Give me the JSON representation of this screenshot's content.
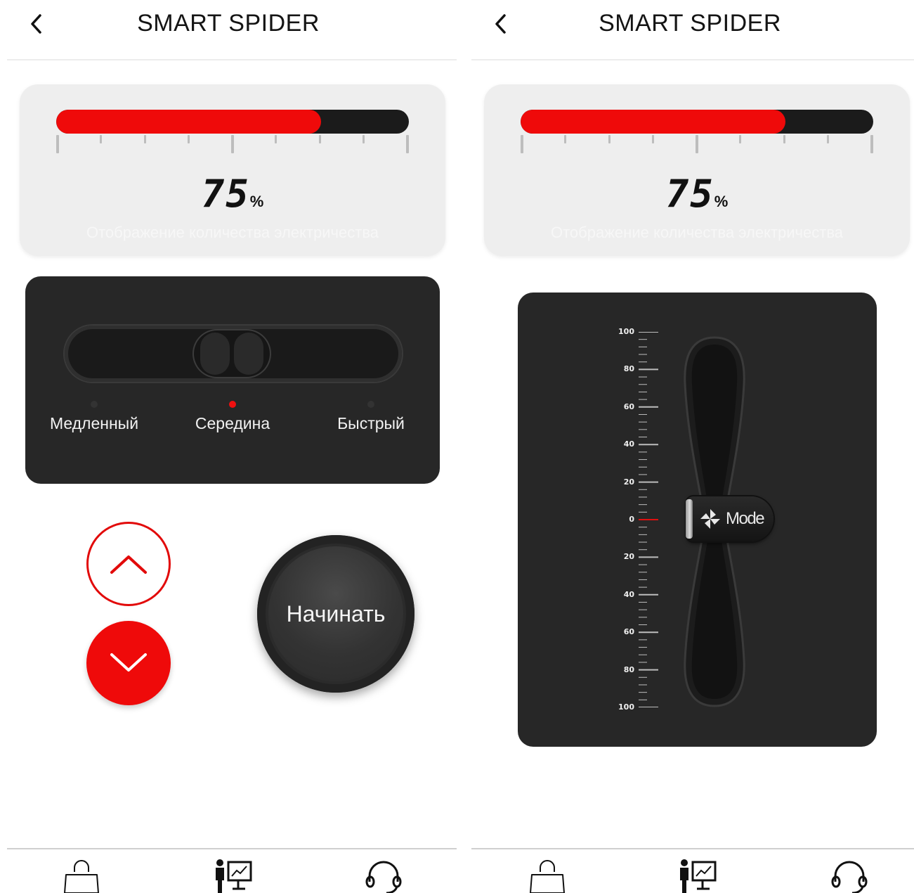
{
  "screens": [
    {
      "header": {
        "title": "SMART SPIDER"
      },
      "battery": {
        "percent": 75,
        "value_text": "75",
        "unit": "%",
        "caption": "Отображение количества электричества"
      },
      "speed": {
        "options": [
          "Медленный",
          "Середина",
          "Быстрый"
        ],
        "selected_index": 1
      },
      "start_button": {
        "label": "Начинать"
      },
      "bottom_nav": {
        "items": [
          "shopping-bag-icon",
          "presentation-icon",
          "headset-icon"
        ],
        "active_index": 1
      }
    },
    {
      "header": {
        "title": "SMART SPIDER"
      },
      "battery": {
        "percent": 75,
        "value_text": "75",
        "unit": "%",
        "caption": "Отображение количества электричества"
      },
      "mode_control": {
        "scale_labels": [
          "100",
          "80",
          "60",
          "40",
          "20",
          "0",
          "20",
          "40",
          "60",
          "80",
          "100"
        ],
        "knob_label": "Mode",
        "knob_level": 0
      },
      "bottom_nav": {
        "items": [
          "shopping-bag-icon",
          "presentation-icon",
          "headset-icon"
        ],
        "active_index": 1
      }
    }
  ],
  "colors": {
    "accent": "#ef0a0a",
    "dark_card": "#272727",
    "battery_card": "#eeeeee"
  }
}
